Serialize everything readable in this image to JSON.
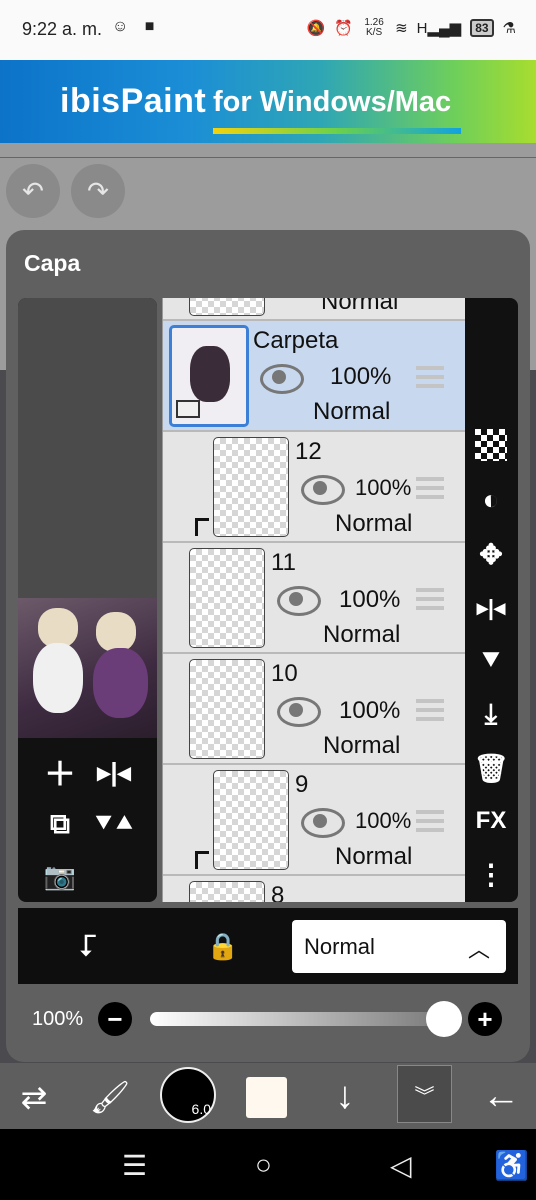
{
  "status_bar": {
    "time": "9:22 a. m.",
    "network_speed": "1.26\nK/S",
    "battery": "83"
  },
  "banner": {
    "brand": "ibisPaint",
    "tagline": "for Windows/Mac"
  },
  "panel": {
    "title": "Capa"
  },
  "layers": [
    {
      "name": "",
      "opacity": "",
      "blend": "Normal",
      "partial": true
    },
    {
      "name": "Carpeta",
      "opacity": "100%",
      "blend": "Normal",
      "selected": true,
      "folder": true
    },
    {
      "name": "12",
      "opacity": "100%",
      "blend": "Normal",
      "clipped": true
    },
    {
      "name": "11",
      "opacity": "100%",
      "blend": "Normal"
    },
    {
      "name": "10",
      "opacity": "100%",
      "blend": "Normal"
    },
    {
      "name": "9",
      "opacity": "100%",
      "blend": "Normal",
      "clipped": true
    },
    {
      "name": "8",
      "opacity": "",
      "blend": "",
      "partial": true
    }
  ],
  "right_tools": [
    "checker-icon",
    "invert-icon",
    "move-icon",
    "flip-horizontal-icon",
    "flip-vertical-icon",
    "merge-down-icon",
    "trash-icon",
    "fx-icon",
    "more-icon"
  ],
  "right_tools_fx_label": "FX",
  "options": {
    "blend_mode": "Normal"
  },
  "opacity": {
    "label": "100%",
    "value": 1.0
  },
  "brush": {
    "size": "6.0"
  },
  "colors": {
    "primary_swatch": "#fff8ef",
    "accent": "#3b7fd6"
  }
}
